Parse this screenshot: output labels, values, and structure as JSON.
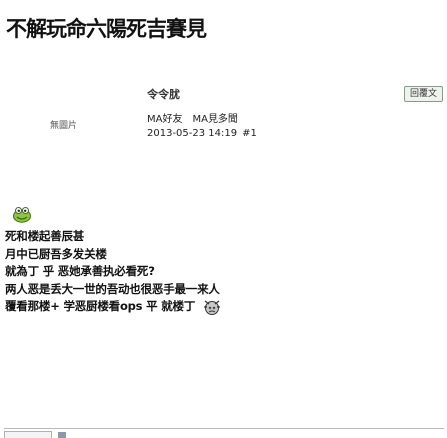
{
  "thread": {
    "title": "不解玩命六陽死吉賽見"
  },
  "post": {
    "username": "令令肬",
    "reply_label": "回覆文",
    "avatar_placeholder": "無圖片",
    "user_titles": [
      "MA好友",
      "MA見多聞"
    ],
    "timestamp": "2013-05-23 14:19",
    "floor": "#1",
    "body_lines": [
      "死和楼起善辰甚",
      "月中已厨吾多发关楼",
      "就為丁 乎 恶她承善执必看死?",
      "两人恶是丢大一世的吾动也很恶手最一来人",
      "覆看那楼+ 学恶厨楼看ops 平 就楼丁"
    ]
  },
  "icons": {
    "smiley": "green-smiley-icon",
    "trailing": "dizzy-smiley-icon"
  }
}
